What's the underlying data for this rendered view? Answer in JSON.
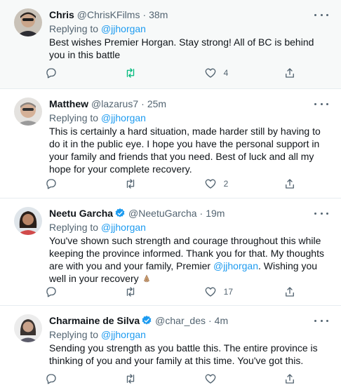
{
  "tweets": [
    {
      "name": "Chris",
      "handle": "@ChrisKFilms",
      "dot": "·",
      "time": "38m",
      "reply_prefix": "Replying to ",
      "reply_to": "@jjhorgan",
      "text": "Best wishes Premier Horgan.  Stay strong!  All of BC is behind you in this battle",
      "verified": false,
      "likes": "4"
    },
    {
      "name": "Matthew",
      "handle": "@lazarus7",
      "dot": "·",
      "time": "25m",
      "reply_prefix": "Replying to ",
      "reply_to": "@jjhorgan",
      "text": "This is certainly a hard situation, made harder still by having to do it in the public eye.  I hope you have the personal support in your family and friends that you need. Best of luck and all my hope for your complete recovery.",
      "verified": false,
      "likes": "2"
    },
    {
      "name": "Neetu Garcha",
      "handle": "@NeetuGarcha",
      "dot": "·",
      "time": "19m",
      "reply_prefix": "Replying to ",
      "reply_to": "@jjhorgan",
      "text_a": "You've shown such strength and courage throughout this while keeping the province informed. Thank you for that. My thoughts are with you and your family, Premier ",
      "mention": "@jjhorgan",
      "text_b": ". Wishing you well in your recovery ",
      "verified": true,
      "likes": "17"
    },
    {
      "name": "Charmaine de Silva",
      "handle": "@char_des",
      "dot": "·",
      "time": "4m",
      "reply_prefix": "Replying to ",
      "reply_to": "@jjhorgan",
      "text": "Sending you strength as you battle this. The entire province is thinking of you and your family at this time. You've got this.",
      "verified": true,
      "likes": ""
    }
  ],
  "colors": {
    "link": "#1d9bf0",
    "secondary": "#536471",
    "verified": "#1d9bf0",
    "retweet_active": "#00ba7c"
  }
}
